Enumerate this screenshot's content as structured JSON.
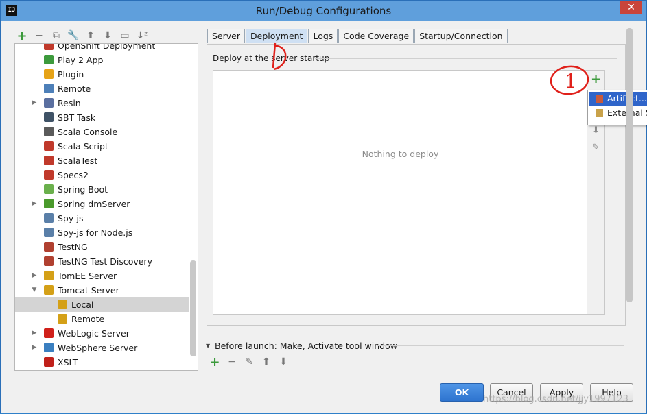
{
  "window": {
    "title": "Run/Debug Configurations",
    "app_icon": "IJ",
    "close_glyph": "✕"
  },
  "toolbar": [
    {
      "name": "add-config-icon",
      "glyph": "+"
    },
    {
      "name": "remove-config-icon",
      "glyph": "−"
    },
    {
      "name": "copy-config-icon",
      "glyph": "⧉"
    },
    {
      "name": "edit-defaults-icon",
      "glyph": "🔧"
    },
    {
      "name": "move-up-icon",
      "glyph": "⬆"
    },
    {
      "name": "move-down-icon",
      "glyph": "⬇"
    },
    {
      "name": "folder-icon",
      "glyph": "▭"
    },
    {
      "name": "sort-icon",
      "glyph": "↓ᶻ"
    }
  ],
  "tree": [
    {
      "label": "OpenShift Deployment",
      "indent": 1,
      "icon": "openshift-icon",
      "color": "#c0392b",
      "expandable": false
    },
    {
      "label": "Play 2 App",
      "indent": 1,
      "icon": "play2-icon",
      "color": "#3c9a3c",
      "expandable": false
    },
    {
      "label": "Plugin",
      "indent": 1,
      "icon": "plugin-icon",
      "color": "#e6a317",
      "expandable": false
    },
    {
      "label": "Remote",
      "indent": 1,
      "icon": "remote-icon",
      "color": "#4d7fb8",
      "expandable": false
    },
    {
      "label": "Resin",
      "indent": 1,
      "icon": "resin-icon",
      "color": "#5a6fa0",
      "expandable": true
    },
    {
      "label": "SBT Task",
      "indent": 1,
      "icon": "sbt-icon",
      "color": "#3f5266",
      "expandable": false
    },
    {
      "label": "Scala Console",
      "indent": 1,
      "icon": "scala-console-icon",
      "color": "#5a5a5a",
      "expandable": false
    },
    {
      "label": "Scala Script",
      "indent": 1,
      "icon": "scala-script-icon",
      "color": "#c0392b",
      "expandable": false
    },
    {
      "label": "ScalaTest",
      "indent": 1,
      "icon": "scalatest-icon",
      "color": "#c0392b",
      "expandable": false
    },
    {
      "label": "Specs2",
      "indent": 1,
      "icon": "specs2-icon",
      "color": "#c0392b",
      "expandable": false
    },
    {
      "label": "Spring Boot",
      "indent": 1,
      "icon": "spring-boot-icon",
      "color": "#6ab04c",
      "expandable": false
    },
    {
      "label": "Spring dmServer",
      "indent": 1,
      "icon": "spring-dm-icon",
      "color": "#4a9a2c",
      "expandable": true
    },
    {
      "label": "Spy-js",
      "indent": 1,
      "icon": "spyjs-icon",
      "color": "#5a7fa8",
      "expandable": false
    },
    {
      "label": "Spy-js for Node.js",
      "indent": 1,
      "icon": "spyjs-node-icon",
      "color": "#5a7fa8",
      "expandable": false
    },
    {
      "label": "TestNG",
      "indent": 1,
      "icon": "testng-icon",
      "color": "#b04030",
      "expandable": false
    },
    {
      "label": "TestNG Test Discovery",
      "indent": 1,
      "icon": "testng-discovery-icon",
      "color": "#b04030",
      "expandable": false
    },
    {
      "label": "TomEE Server",
      "indent": 1,
      "icon": "tomee-icon",
      "color": "#d4a017",
      "expandable": true
    },
    {
      "label": "Tomcat Server",
      "indent": 1,
      "icon": "tomcat-icon",
      "color": "#d4a017",
      "expandable": true,
      "expanded": true
    },
    {
      "label": "Local",
      "indent": 2,
      "icon": "tomcat-local-icon",
      "color": "#d4a017",
      "expandable": false,
      "selected": true
    },
    {
      "label": "Remote",
      "indent": 2,
      "icon": "tomcat-remote-icon",
      "color": "#d4a017",
      "expandable": false
    },
    {
      "label": "WebLogic Server",
      "indent": 1,
      "icon": "weblogic-icon",
      "color": "#d0201a",
      "expandable": true
    },
    {
      "label": "WebSphere Server",
      "indent": 1,
      "icon": "websphere-icon",
      "color": "#3a7fc0",
      "expandable": true
    },
    {
      "label": "XSLT",
      "indent": 1,
      "icon": "xslt-icon",
      "color": "#c0201a",
      "expandable": false
    }
  ],
  "tabs": [
    {
      "label": "Server",
      "active": false
    },
    {
      "label": "Deployment",
      "active": true
    },
    {
      "label": "Logs",
      "active": false
    },
    {
      "label": "Code Coverage",
      "active": false
    },
    {
      "label": "Startup/Connection",
      "active": false
    }
  ],
  "deployment": {
    "section_title": "Deploy at the server startup",
    "empty_text": "Nothing to deploy"
  },
  "side_tools": [
    {
      "name": "add-icon",
      "glyph": "+"
    },
    {
      "name": "move-down-icon",
      "glyph": "⬇"
    },
    {
      "name": "edit-icon",
      "glyph": "✎"
    }
  ],
  "popup": [
    {
      "label": "Artifact...",
      "icon": "artifact-icon",
      "highlighted": true
    },
    {
      "label": "External Source...",
      "icon": "external-source-icon",
      "highlighted": false
    }
  ],
  "before_launch": {
    "label": "Before launch: Make, Activate tool window",
    "toggle_glyph": "▼",
    "tools": [
      {
        "name": "add-task-icon",
        "glyph": "+"
      },
      {
        "name": "remove-task-icon",
        "glyph": "−"
      },
      {
        "name": "edit-task-icon",
        "glyph": "✎"
      },
      {
        "name": "move-up-icon",
        "glyph": "⬆"
      },
      {
        "name": "move-down-icon",
        "glyph": "⬇"
      }
    ]
  },
  "buttons": {
    "ok": "OK",
    "cancel": "Cancel",
    "apply": "Apply",
    "help": "Help"
  },
  "watermark": "https://blog.csdn.net/jjy1997123",
  "annotations": {
    "one": "1",
    "two": "1"
  }
}
